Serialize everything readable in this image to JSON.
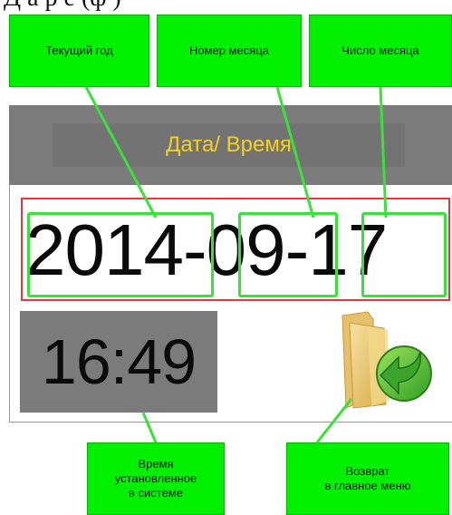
{
  "top_caption": "Д  а  р  е  (ф    )",
  "callouts": {
    "year": "Текущий год",
    "month": "Номер месяца",
    "day": "Число месяца",
    "time": "Время\nустановленное\nв системе",
    "back": "Возврат\nв главное меню"
  },
  "screen": {
    "title": "Дата/ Время",
    "date": {
      "year": "2014",
      "sep1": "-",
      "month": "09",
      "sep2": "-",
      "day": "17"
    },
    "time": "16:49",
    "back_icon": "folder-return-icon"
  },
  "colors": {
    "callout_green": "#00f000",
    "highlight_green": "#39e23a",
    "title_yellow": "#f3d21d",
    "panel_gray": "#7b7b7b",
    "date_border_red": "#e53935"
  }
}
